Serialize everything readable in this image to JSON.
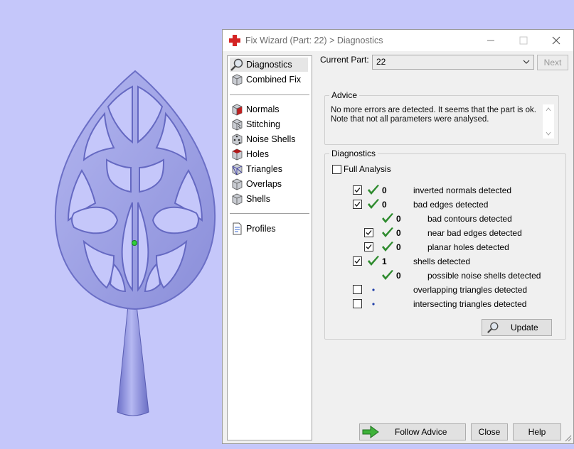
{
  "dialog": {
    "title": "Fix Wizard (Part: 22) > Diagnostics",
    "current_part_label": "Current Part:",
    "current_part_value": "22",
    "next_label": "Next"
  },
  "sidebar": {
    "top_items": [
      {
        "label": "Diagnostics",
        "icon": "magnifier-icon",
        "selected": true
      },
      {
        "label": "Combined Fix",
        "icon": "cube-icon",
        "selected": false
      }
    ],
    "fix_items": [
      {
        "label": "Normals",
        "icon": "normals-cube-icon"
      },
      {
        "label": "Stitching",
        "icon": "stitching-cube-icon"
      },
      {
        "label": "Noise Shells",
        "icon": "noise-shells-cube-icon"
      },
      {
        "label": "Holes",
        "icon": "holes-cube-icon"
      },
      {
        "label": "Triangles",
        "icon": "triangles-cube-icon"
      },
      {
        "label": "Overlaps",
        "icon": "overlaps-cube-icon"
      },
      {
        "label": "Shells",
        "icon": "shells-cube-icon"
      }
    ],
    "bottom_items": [
      {
        "label": "Profiles",
        "icon": "document-icon"
      }
    ]
  },
  "advice": {
    "title": "Advice",
    "line1": "No more errors are detected. It seems that the part is ok.",
    "line2": "Note that not all parameters were analysed."
  },
  "diagnostics": {
    "title": "Diagnostics",
    "full_analysis_label": "Full Analysis",
    "full_analysis_checked": false,
    "rows": [
      {
        "indent": 0,
        "checkbox": true,
        "checked": true,
        "status": "ok",
        "count": "0",
        "label": "inverted normals detected"
      },
      {
        "indent": 0,
        "checkbox": true,
        "checked": true,
        "status": "ok",
        "count": "0",
        "label": "bad edges detected"
      },
      {
        "indent": 1,
        "checkbox": false,
        "checked": false,
        "status": "ok",
        "count": "0",
        "label": "bad contours detected"
      },
      {
        "indent": 1,
        "checkbox": true,
        "checked": true,
        "status": "ok",
        "count": "0",
        "label": "near bad edges detected"
      },
      {
        "indent": 1,
        "checkbox": true,
        "checked": true,
        "status": "ok",
        "count": "0",
        "label": "planar holes detected"
      },
      {
        "indent": 0,
        "checkbox": true,
        "checked": true,
        "status": "ok",
        "count": "1",
        "label": "shells detected"
      },
      {
        "indent": 1,
        "checkbox": false,
        "checked": false,
        "status": "ok",
        "count": "0",
        "label": "possible noise shells detected"
      },
      {
        "indent": 0,
        "checkbox": true,
        "checked": false,
        "status": "pending",
        "count": "",
        "label": "overlapping triangles detected"
      },
      {
        "indent": 0,
        "checkbox": true,
        "checked": false,
        "status": "pending",
        "count": "",
        "label": "intersecting triangles detected"
      }
    ],
    "update_label": "Update"
  },
  "buttons": {
    "follow_advice": "Follow Advice",
    "close": "Close",
    "help": "Help"
  },
  "colors": {
    "viewport_bg": "#c5c7fa",
    "model": "#9a9ee6",
    "check_green": "#2e8b2e",
    "pending_blue": "#1f3ea8"
  }
}
